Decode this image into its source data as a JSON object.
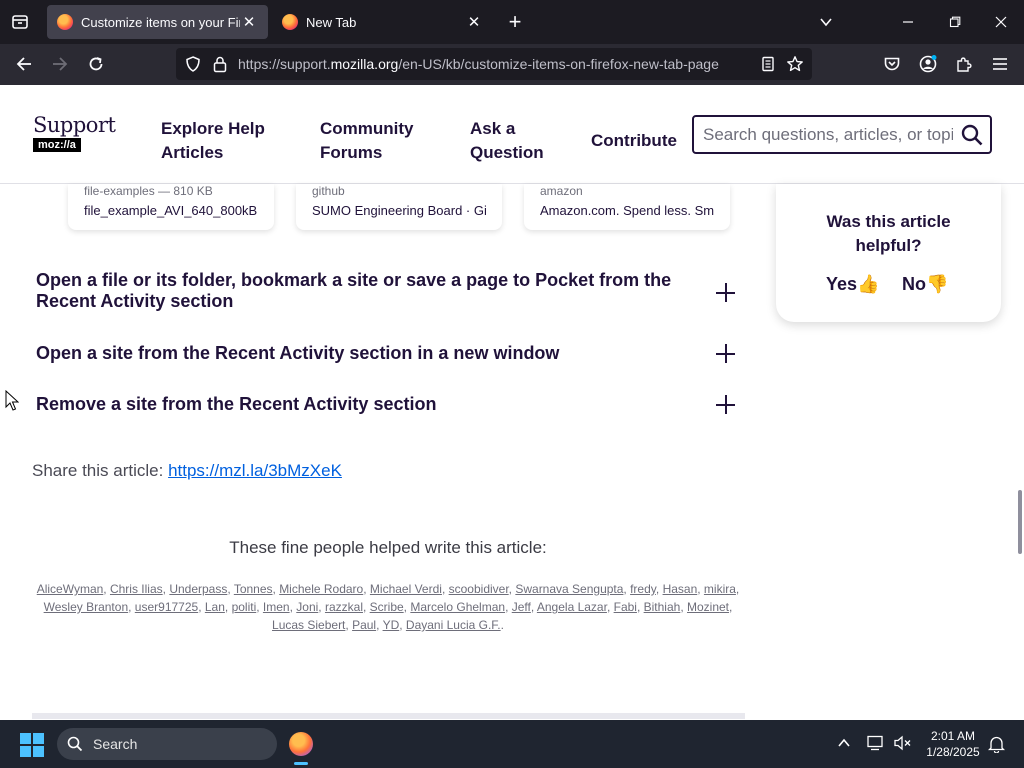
{
  "browser": {
    "tabs": [
      {
        "title": "Customize items on your Firefox",
        "close": "✕"
      },
      {
        "title": "New Tab",
        "close": "✕"
      }
    ],
    "new_tab": "+",
    "url_prefix": "https://support.",
    "url_domain": "mozilla.org",
    "url_path": "/en-US/kb/customize-items-on-firefox-new-tab-page"
  },
  "site": {
    "logo_text": "Support",
    "logo_badge": "moz://a",
    "nav": {
      "explore_line1": "Explore Help",
      "explore_line2": "Articles",
      "forums_line1": "Community",
      "forums_line2": "Forums",
      "ask_line1": "Ask a",
      "ask_line2": "Question",
      "contribute": "Contribute"
    },
    "search_placeholder": "Search questions, articles, or topics"
  },
  "cards": [
    {
      "source": "file-examples — 810 KB",
      "title": "file_example_AVI_640_800kB"
    },
    {
      "source": "github",
      "title": "SUMO Engineering Board · GitHub"
    },
    {
      "source": "amazon",
      "title": "Amazon.com. Spend less. Smile more."
    }
  ],
  "sections": [
    {
      "line1": "Open a file or its folder, bookmark a site or save a page to Pocket from the",
      "line2": "Recent Activity section"
    },
    {
      "line1": "Open a site from the Recent Activity section in a new window"
    },
    {
      "line1": "Remove a site from the Recent Activity section"
    }
  ],
  "share": {
    "label": "Share this article:",
    "link": "https://mzl.la/3bMzXeK"
  },
  "helped_heading": "These fine people helped write this article:",
  "contributors": [
    "AliceWyman",
    "Chris Ilias",
    "Underpass",
    "Tonnes",
    "Michele Rodaro",
    "Michael Verdi",
    "scoobidiver",
    "Swarnava Sengupta",
    "fredy",
    "Hasan",
    "mikira",
    "Wesley Branton",
    "user917725",
    "Lan",
    "politi",
    "Imen",
    "Joni",
    "razzkal",
    "Scribe",
    "Marcelo Ghelman",
    "Jeff",
    "Angela Lazar",
    "Fabi",
    "Bithiah",
    "Mozinet",
    "Lucas Siebert",
    "Paul",
    "YD",
    "Dayani Lucia G.F."
  ],
  "helpful": {
    "line1": "Was this article",
    "line2": "helpful?",
    "yes": "Yes👍",
    "no": "No👎"
  },
  "taskbar": {
    "search": "Search",
    "time": "2:01 AM",
    "date": "1/28/2025"
  },
  "colors": {
    "accent": "#0060df",
    "text": "#20123a",
    "chrome_dark": "#1c1b22",
    "chrome": "#2b2a33"
  }
}
